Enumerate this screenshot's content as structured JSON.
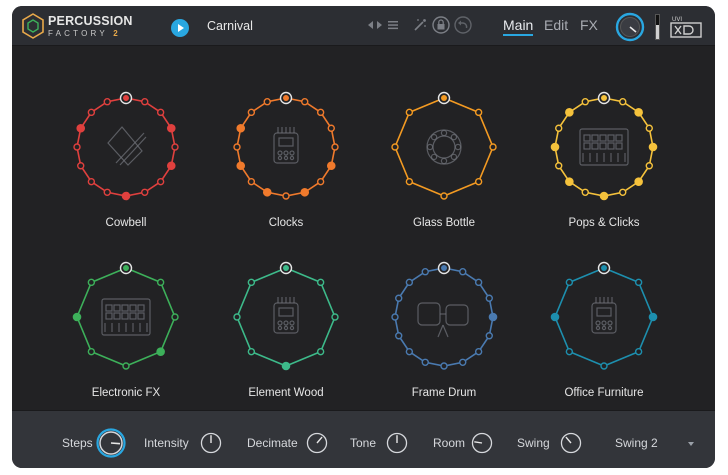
{
  "header": {
    "logo_line1": "PERCUSSION",
    "logo_line2": "FACTORY",
    "logo_version": "2",
    "preset_name": "Carnival",
    "tabs": [
      {
        "label": "Main",
        "active": true
      },
      {
        "label": "Edit",
        "active": false
      },
      {
        "label": "FX",
        "active": false
      }
    ],
    "brand": "UVI",
    "accent_color": "#29a7e1"
  },
  "pads": [
    {
      "label": "Cowbell",
      "color": "#e0403e",
      "icon": "cowbell-icon",
      "steps": 16,
      "active_steps": [
        3,
        5,
        8,
        13
      ]
    },
    {
      "label": "Clocks",
      "color": "#f07a2c",
      "icon": "recorder-icon",
      "steps": 16,
      "active_steps": [
        5,
        7,
        9,
        11,
        13
      ]
    },
    {
      "label": "Glass Bottle",
      "color": "#f39a22",
      "icon": "tambourine-icon",
      "steps": 8,
      "active_steps": [
        0
      ]
    },
    {
      "label": "Pops & Clicks",
      "color": "#f5c23c",
      "icon": "sequencer-icon",
      "steps": 16,
      "active_steps": [
        0,
        2,
        4,
        6,
        8,
        10,
        12,
        14
      ]
    },
    {
      "label": "Electronic FX",
      "color": "#3db05a",
      "icon": "sequencer-icon",
      "steps": 8,
      "active_steps": [
        3,
        6
      ]
    },
    {
      "label": "Element Wood",
      "color": "#3dba8a",
      "icon": "recorder-icon",
      "steps": 8,
      "active_steps": [
        0,
        4
      ]
    },
    {
      "label": "Frame Drum",
      "color": "#4a7ab0",
      "icon": "bongo-icon",
      "steps": 16,
      "active_steps": [
        4
      ]
    },
    {
      "label": "Office Furniture",
      "color": "#1d8fae",
      "icon": "recorder-icon",
      "steps": 8,
      "active_steps": [
        0,
        2,
        6
      ]
    }
  ],
  "footer": {
    "controls": [
      {
        "label": "Steps",
        "value": 0.85,
        "highlight": true
      },
      {
        "label": "Intensity",
        "value": 0.5,
        "highlight": false
      },
      {
        "label": "Decimate",
        "value": 0.65,
        "highlight": false
      },
      {
        "label": "Tone",
        "value": 0.5,
        "highlight": false
      },
      {
        "label": "Room",
        "value": 0.2,
        "highlight": false
      },
      {
        "label": "Swing",
        "value": 0.35,
        "highlight": false
      }
    ],
    "swing_mode": "Swing 2"
  }
}
